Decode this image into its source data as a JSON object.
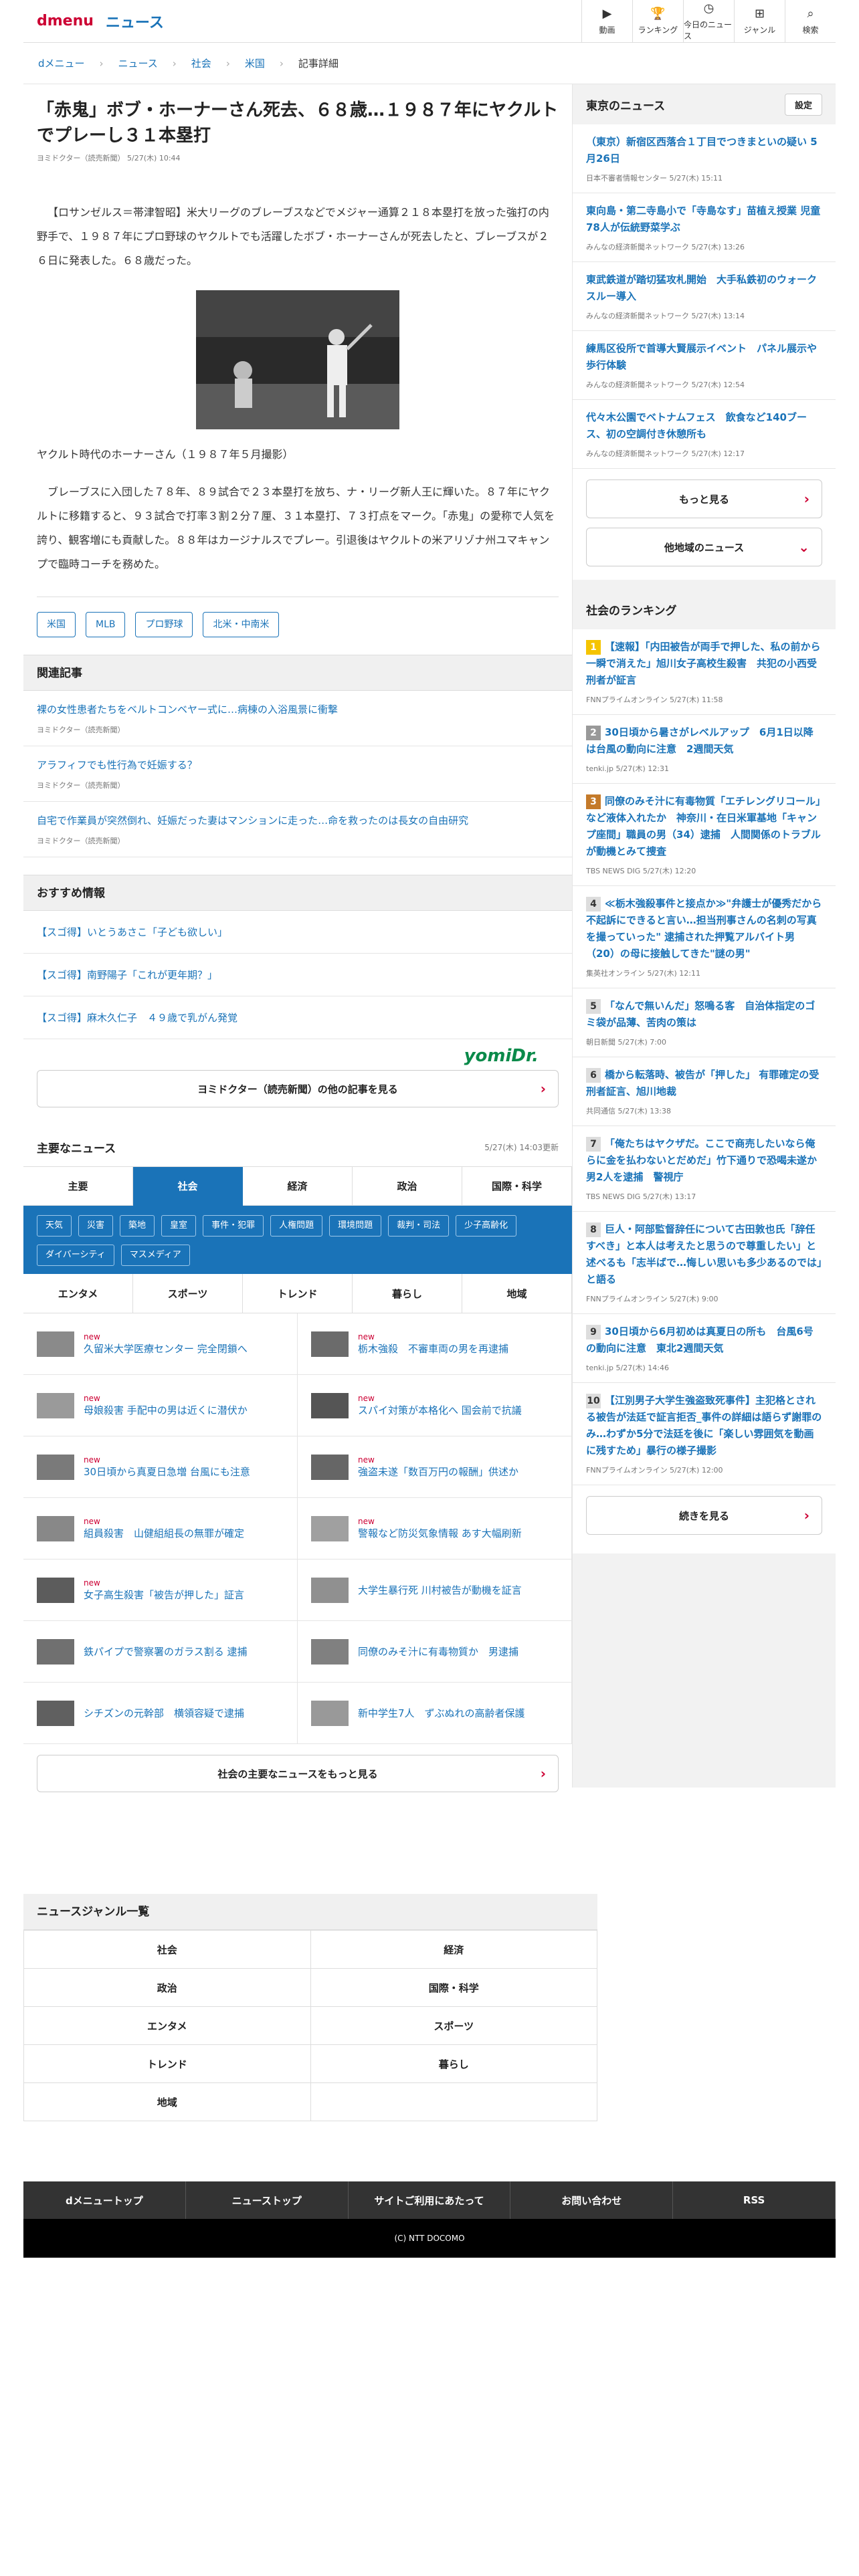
{
  "header": {
    "logo": "dmenu",
    "section": "ニュース",
    "nav": [
      {
        "icon": "video-icon",
        "glyph": "▶",
        "label": "動画"
      },
      {
        "icon": "trophy-icon",
        "glyph": "🏆",
        "label": "ランキング"
      },
      {
        "icon": "clock-icon",
        "glyph": "◷",
        "label": "今日のニュース"
      },
      {
        "icon": "grid-icon",
        "glyph": "⊞",
        "label": "ジャンル"
      },
      {
        "icon": "search-icon",
        "glyph": "⌕",
        "label": "検索"
      }
    ]
  },
  "breadcrumb": [
    "dメニュー",
    "ニュース",
    "社会",
    "米国",
    "記事詳細"
  ],
  "article": {
    "title": "「赤鬼」ボブ・ホーナーさん死去、６８歳…１９８７年にヤクルトでプレーし３１本塁打",
    "meta": "ヨミドクター（読売新聞） 5/27(木) 10:44",
    "p1": "【ロサンゼルス＝帯津智昭】米大リーグのブレーブスなどでメジャー通算２１８本塁打を放った強打の内野手で、１９８７年にプロ野球のヤクルトでも活躍したボブ・ホーナーさんが死去したと、ブレーブスが２６日に発表した。６８歳だった。",
    "caption": "ヤクルト時代のホーナーさん（１９８７年５月撮影）",
    "p2": "ブレーブスに入団した７８年、８９試合で２３本塁打を放ち、ナ・リーグ新人王に輝いた。８７年にヤクルトに移籍すると、９３試合で打率３割２分７厘、３１本塁打、７３打点をマーク。「赤鬼」の愛称で人気を誇り、観客増にも貢献した。８８年はカージナルスでプレー。引退後はヤクルトの米アリゾナ州ユマキャンプで臨時コーチを務めた。",
    "tags": [
      "米国",
      "MLB",
      "プロ野球",
      "北米・中南米"
    ]
  },
  "related": {
    "heading": "関連記事",
    "items": [
      {
        "title": "裸の女性患者たちをベルトコンベヤー式に…病棟の入浴風景に衝撃",
        "meta": "ヨミドクター（読売新聞）"
      },
      {
        "title": "アラフィフでも性行為で妊娠する？",
        "meta": "ヨミドクター（読売新聞）"
      },
      {
        "title": "自宅で作業員が突然倒れ、妊娠だった妻はマンションに走った…命を救ったのは長女の自由研究",
        "meta": "ヨミドクター（読売新聞）"
      }
    ]
  },
  "recommend": {
    "heading": "おすすめ情報",
    "items": [
      "【スゴ得】いとうあさこ「子ども欲しい」",
      "【スゴ得】南野陽子「これが更年期？」",
      "【スゴ得】麻木久仁子　４９歳で乳がん発覚"
    ],
    "brand": "yomiDr.",
    "more": "ヨミドクター（読売新聞）の他の記事を見る"
  },
  "major": {
    "heading": "主要なニュース",
    "time": "5/27(木) 14:03更新",
    "tabs": [
      "主要",
      "社会",
      "経済",
      "政治",
      "国際・科学"
    ],
    "active_tab": "社会",
    "subcats": [
      "天気",
      "災害",
      "築地",
      "皇室",
      "事件・犯罪",
      "人権問題",
      "環境問題",
      "裁判・司法",
      "少子高齢化",
      "ダイバーシティ",
      "マスメディア"
    ],
    "gtabs": [
      "エンタメ",
      "スポーツ",
      "トレンド",
      "暮らし",
      "地域"
    ],
    "items": [
      {
        "new": "new",
        "title": "久留米大学医療センター 完全閉鎖へ"
      },
      {
        "new": "new",
        "title": "栃木強殺　不審車両の男を再逮捕"
      },
      {
        "new": "new",
        "title": "母娘殺害 手配中の男は近くに潜伏か"
      },
      {
        "new": "new",
        "title": "スパイ対策が本格化へ 国会前で抗議"
      },
      {
        "new": "new",
        "title": "30日頃から真夏日急増 台風にも注意"
      },
      {
        "new": "new",
        "title": "強盗未遂「数百万円の報酬」供述か"
      },
      {
        "new": "new",
        "title": "組員殺害　山健組組長の無罪が確定"
      },
      {
        "new": "new",
        "title": "警報など防災気象情報 あす大幅刷新"
      },
      {
        "new": "new",
        "title": "女子高生殺害「被告が押した」証言"
      },
      {
        "new": "",
        "title": "大学生暴行死 川村被告が動機を証言"
      },
      {
        "new": "",
        "title": "鉄パイプで警察署のガラス割る 逮捕"
      },
      {
        "new": "",
        "title": "同僚のみそ汁に有毒物質か　男逮捕"
      },
      {
        "new": "",
        "title": "シチズンの元幹部　横領容疑で逮捕"
      },
      {
        "new": "",
        "title": "新中学生7人　ずぶぬれの高齢者保護"
      }
    ],
    "more": "社会の主要なニュースをもっと見る"
  },
  "tokyo": {
    "heading": "東京のニュース",
    "settings": "設定",
    "items": [
      {
        "title": "（東京）新宿区西落合１丁目でつきまといの疑い 5月26日",
        "meta": "日本不審者情報センター 5/27(木) 15:11"
      },
      {
        "title": "東向島・第二寺島小で「寺島なす」苗植え授業 児童78人が伝統野菜学ぶ",
        "meta": "みんなの経済新聞ネットワーク 5/27(木) 13:26"
      },
      {
        "title": "東武鉄道が踏切猛攻札開始　大手私鉄初のウォークスルー導入",
        "meta": "みんなの経済新聞ネットワーク 5/27(木) 13:14"
      },
      {
        "title": "練馬区役所で首導大賢展示イベント　パネル展示や歩行体験",
        "meta": "みんなの経済新聞ネットワーク 5/27(木) 12:54"
      },
      {
        "title": "代々木公園でベトナムフェス　飲食など140ブース、初の空調付き休憩所も",
        "meta": "みんなの経済新聞ネットワーク 5/27(木) 12:17"
      }
    ],
    "more": "もっと見る",
    "other": "他地域のニュース"
  },
  "ranking": {
    "heading": "社会のランキング",
    "items": [
      {
        "rank": "1",
        "title": "【速報】「内田被告が両手で押した、私の前から一瞬で消えた」旭川女子高校生殺害　共犯の小西受刑者が証言",
        "meta": "FNNプライムオンライン 5/27(木) 11:58"
      },
      {
        "rank": "2",
        "title": "30日頃から暑さがレベルアップ　6月1日以降は台風の動向に注意　2週間天気",
        "meta": "tenki.jp 5/27(木) 12:31"
      },
      {
        "rank": "3",
        "title": "同僚のみそ汁に有毒物質「エチレングリコール」など液体入れたか　神奈川・在日米軍基地「キャンプ座間」職員の男（34）逮捕　人間関係のトラブルが動機とみて捜査",
        "meta": "TBS NEWS DIG 5/27(木) 12:20"
      },
      {
        "rank": "4",
        "title": "≪栃木強殺事件と接点か≫\"弁護士が優秀だから不起訴にできると言い…担当刑事さんの名刺の写真を撮っていった\" 逮捕された押覧アルバイト男（20）の母に接触してきた\"謎の男\"",
        "meta": "集英社オンライン 5/27(木) 12:11"
      },
      {
        "rank": "5",
        "title": "「なんで無いんだ」怒鳴る客　自治体指定のゴミ袋が品薄、苦肉の策は",
        "meta": "朝日新聞 5/27(木) 7:00"
      },
      {
        "rank": "6",
        "title": "橋から転落時、被告が「押した」 有罪確定の受刑者証言、旭川地裁",
        "meta": "共同通信 5/27(木) 13:38"
      },
      {
        "rank": "7",
        "title": "「俺たちはヤクザだ。ここで商売したいなら俺らに金を払わないとだめだ」竹下通りで恐喝未遂か　男2人を逮捕　警視庁",
        "meta": "TBS NEWS DIG 5/27(木) 13:17"
      },
      {
        "rank": "8",
        "title": "巨人・阿部監督辞任について古田敦也氏「辞任すべき」と本人は考えたと思うので尊重したい」と述べるも「志半ばで…悔しい思いも多少あるのでは」と語る",
        "meta": "FNNプライムオンライン 5/27(木) 9:00"
      },
      {
        "rank": "9",
        "title": "30日頃から6月初めは真夏日の所も　台風6号の動向に注意　東北2週間天気",
        "meta": "tenki.jp 5/27(木) 14:46"
      },
      {
        "rank": "10",
        "title": "【江別男子大学生強盗致死事件】主犯格とされる被告が法廷で証言拒否_事件の詳細は語らず謝罪のみ…わずか5分で法廷を後に「楽しい雰囲気を動画に残すため」暴行の様子撮影",
        "meta": "FNNプライムオンライン 5/27(木) 12:00"
      }
    ],
    "more": "続きを見る"
  },
  "genre": {
    "heading": "ニュースジャンル一覧",
    "items": [
      "社会",
      "経済",
      "政治",
      "国際・科学",
      "エンタメ",
      "スポーツ",
      "トレンド",
      "暮らし",
      "地域",
      ""
    ]
  },
  "footer": {
    "links": [
      "dメニュートップ",
      "ニューストップ",
      "サイトご利用にあたって",
      "お問い合わせ",
      "RSS"
    ],
    "copyright": "(C) NTT DOCOMO"
  },
  "colors": {
    "brand": "#cc0033",
    "link": "#1a73b8"
  }
}
